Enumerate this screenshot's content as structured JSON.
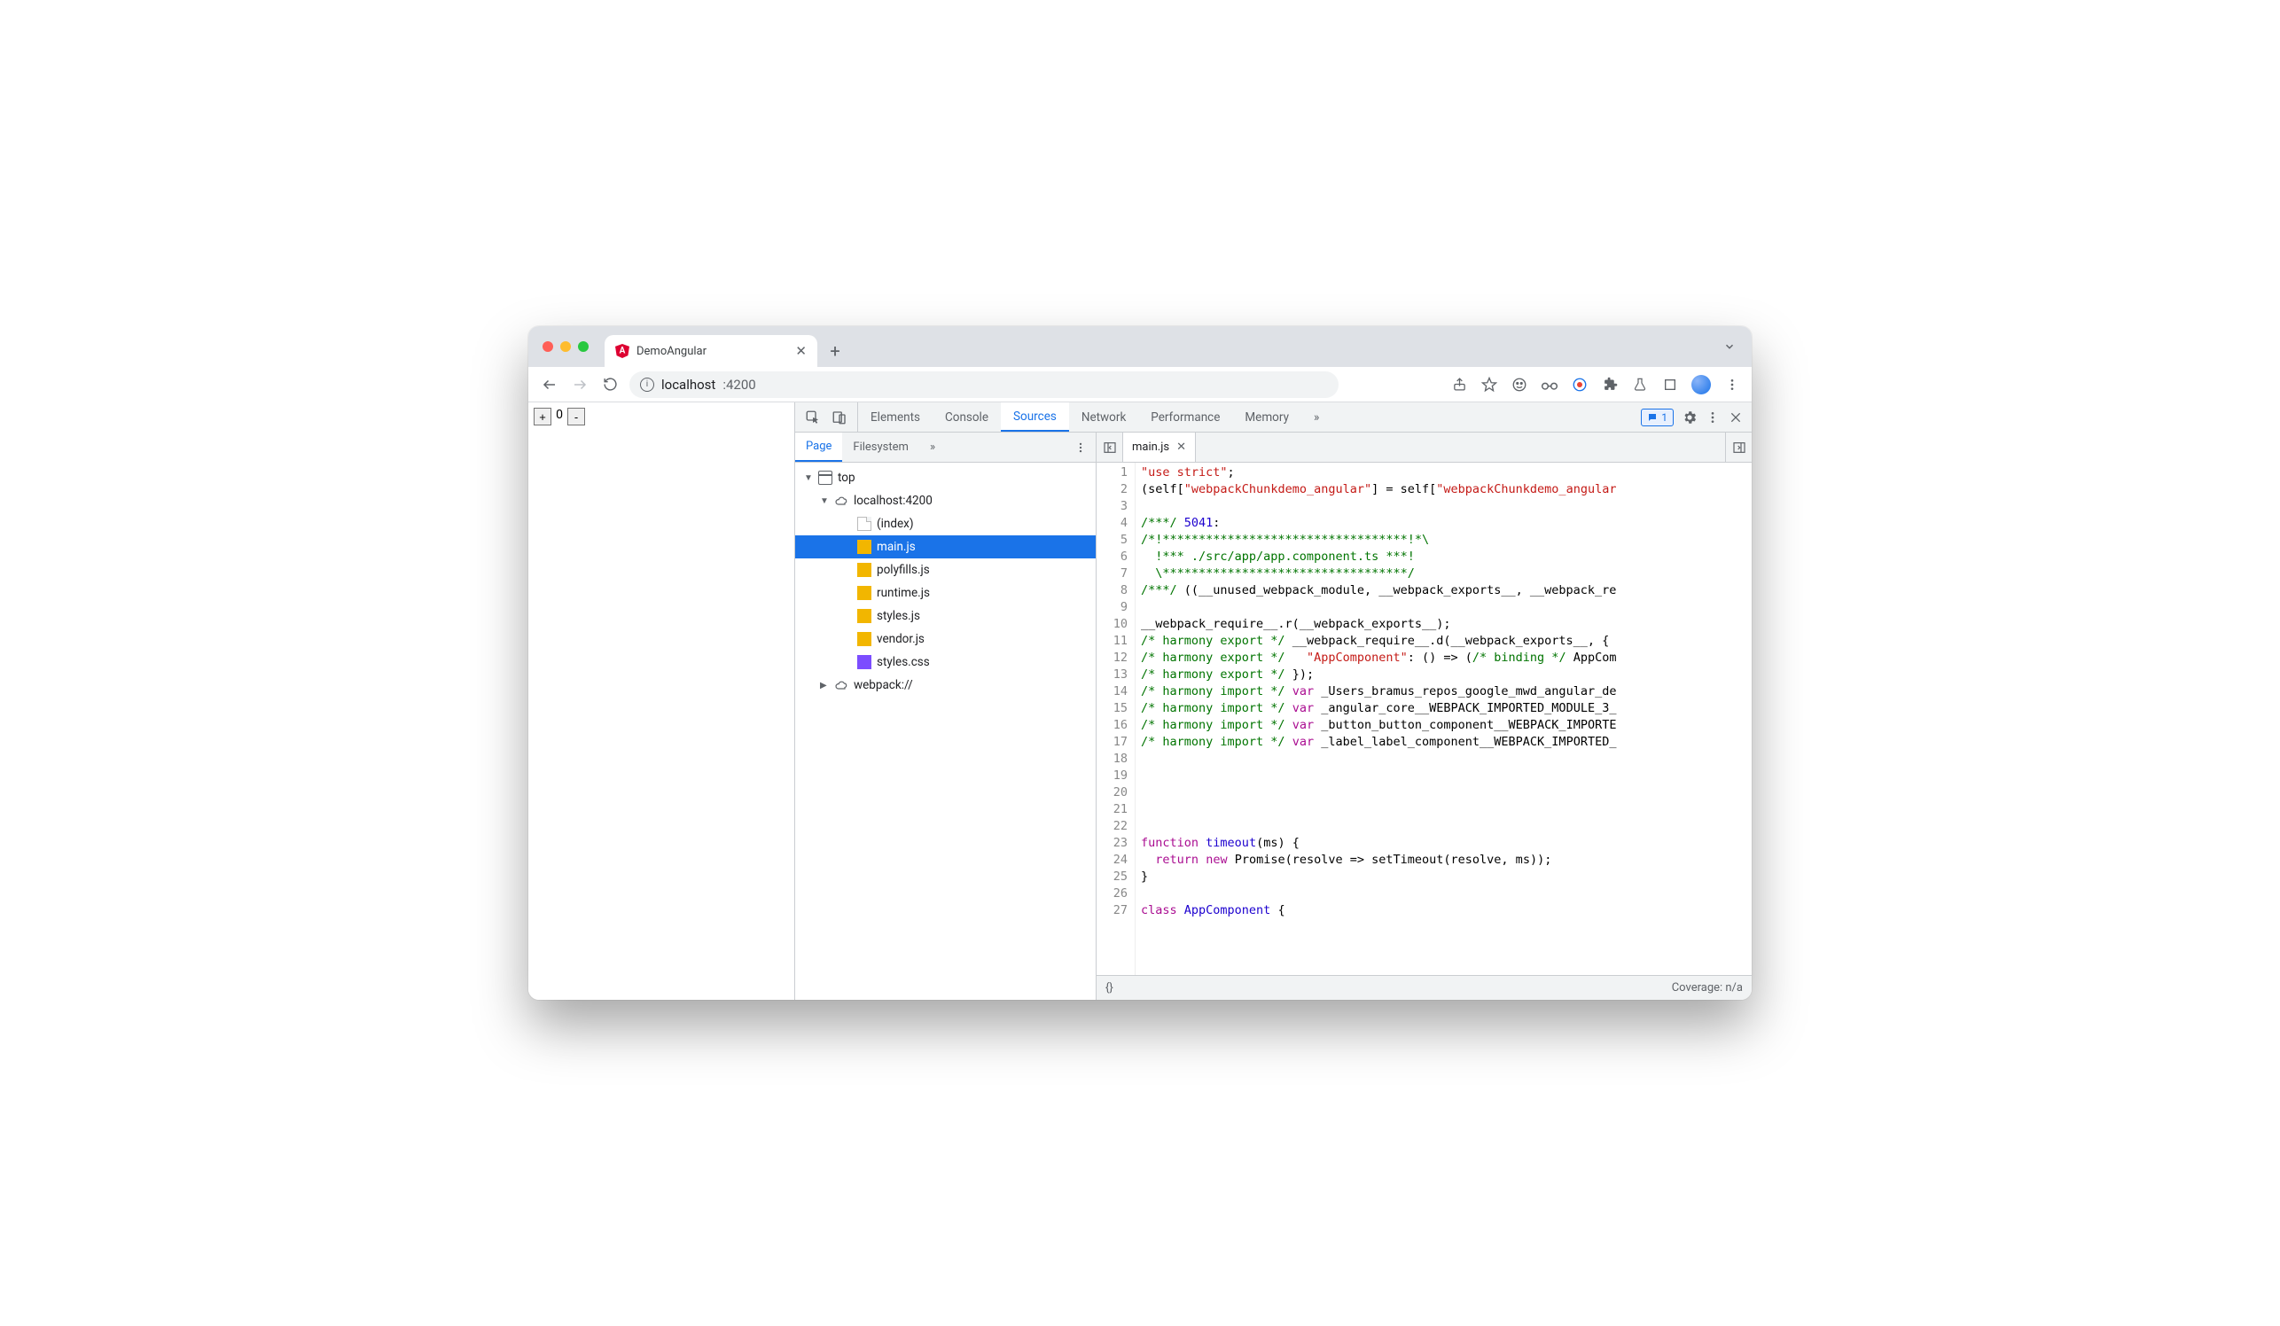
{
  "browser": {
    "tab_title": "DemoAngular",
    "url_host": "localhost",
    "url_port": ":4200"
  },
  "page": {
    "plus": "+",
    "count": "0",
    "minus": "-"
  },
  "devtools": {
    "panels": [
      "Elements",
      "Console",
      "Sources",
      "Network",
      "Performance",
      "Memory"
    ],
    "active_panel": "Sources",
    "messages": "1",
    "navigator": {
      "tabs": [
        "Page",
        "Filesystem"
      ],
      "active": "Page",
      "tree": {
        "top": "top",
        "origin": "localhost:4200",
        "files": [
          "(index)",
          "main.js",
          "polyfills.js",
          "runtime.js",
          "styles.js",
          "vendor.js",
          "styles.css"
        ],
        "selected": "main.js",
        "extra": "webpack://"
      }
    },
    "editor": {
      "open_file": "main.js",
      "coverage": "Coverage: n/a",
      "pretty": "{}",
      "lines": [
        {
          "n": 1,
          "h": "<span class='tok-str'>\"use strict\"</span>;"
        },
        {
          "n": 2,
          "h": "(self[<span class='tok-str'>\"webpackChunkdemo_angular\"</span>] = self[<span class='tok-str'>\"webpackChunkdemo_angular"
        },
        {
          "n": 3,
          "h": ""
        },
        {
          "n": 4,
          "h": "<span class='tok-com'>/***/</span> <span class='tok-num'>5041</span>:"
        },
        {
          "n": 5,
          "h": "<span class='tok-com'>/*!**********************************!*\\</span>"
        },
        {
          "n": 6,
          "h": "<span class='tok-com'>  !*** ./src/app/app.component.ts ***!</span>"
        },
        {
          "n": 7,
          "h": "<span class='tok-com'>  \\**********************************/</span>"
        },
        {
          "n": 8,
          "h": "<span class='tok-com'>/***/</span> ((__unused_webpack_module, __webpack_exports__, __webpack_re"
        },
        {
          "n": 9,
          "h": ""
        },
        {
          "n": 10,
          "h": "__webpack_require__.r(__webpack_exports__);"
        },
        {
          "n": 11,
          "h": "<span class='tok-com'>/* harmony export */</span> __webpack_require__.d(__webpack_exports__, {"
        },
        {
          "n": 12,
          "h": "<span class='tok-com'>/* harmony export */</span>   <span class='tok-str'>\"AppComponent\"</span>: () =&gt; (<span class='tok-com'>/* binding */</span> AppCom"
        },
        {
          "n": 13,
          "h": "<span class='tok-com'>/* harmony export */</span> });"
        },
        {
          "n": 14,
          "h": "<span class='tok-com'>/* harmony import */</span> <span class='tok-kw'>var</span> _Users_bramus_repos_google_mwd_angular_de"
        },
        {
          "n": 15,
          "h": "<span class='tok-com'>/* harmony import */</span> <span class='tok-kw'>var</span> _angular_core__WEBPACK_IMPORTED_MODULE_3_"
        },
        {
          "n": 16,
          "h": "<span class='tok-com'>/* harmony import */</span> <span class='tok-kw'>var</span> _button_button_component__WEBPACK_IMPORTE"
        },
        {
          "n": 17,
          "h": "<span class='tok-com'>/* harmony import */</span> <span class='tok-kw'>var</span> _label_label_component__WEBPACK_IMPORTED_"
        },
        {
          "n": 18,
          "h": ""
        },
        {
          "n": 19,
          "h": ""
        },
        {
          "n": 20,
          "h": ""
        },
        {
          "n": 21,
          "h": ""
        },
        {
          "n": 22,
          "h": ""
        },
        {
          "n": 23,
          "h": "<span class='tok-kw'>function</span> <span class='tok-def'>timeout</span>(ms) {"
        },
        {
          "n": 24,
          "h": "  <span class='tok-kw'>return</span> <span class='tok-kw'>new</span> Promise(resolve =&gt; setTimeout(resolve, ms));"
        },
        {
          "n": 25,
          "h": "}"
        },
        {
          "n": 26,
          "h": ""
        },
        {
          "n": 27,
          "h": "<span class='tok-kw'>class</span> <span class='tok-def'>AppComponent</span> {"
        }
      ]
    }
  }
}
